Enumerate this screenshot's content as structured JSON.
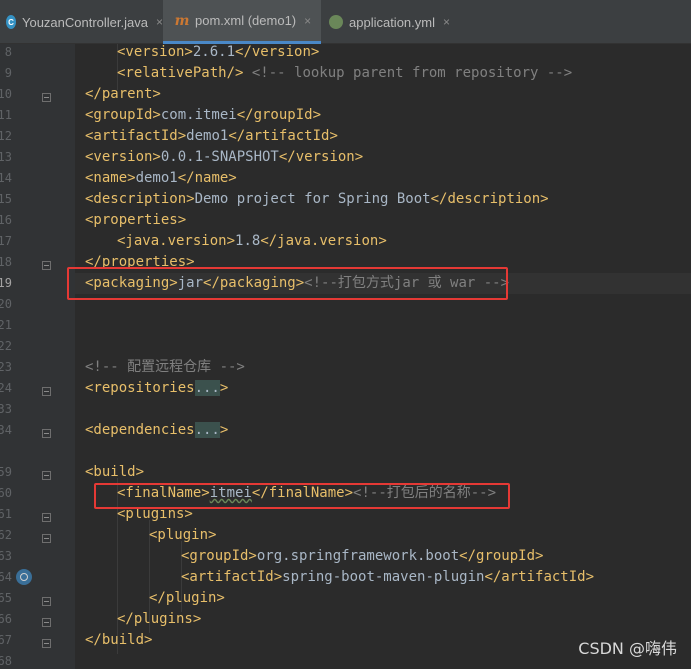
{
  "tabs": [
    {
      "label": "YouzanController.java",
      "icon": "java-class-icon",
      "active": false
    },
    {
      "label": "pom.xml (demo1)",
      "icon": "maven-icon",
      "active": true
    },
    {
      "label": "application.yml",
      "icon": "spring-yaml-icon",
      "active": false
    }
  ],
  "close_glyph": "×",
  "line_numbers": [
    "8",
    "9",
    "10",
    "11",
    "12",
    "13",
    "14",
    "15",
    "16",
    "17",
    "18",
    "19",
    "20",
    "21",
    "22",
    "23",
    "24",
    "33",
    "34",
    "59",
    "60",
    "61",
    "62",
    "63",
    "64",
    "65",
    "66",
    "67",
    "68"
  ],
  "code": {
    "l8": [
      "<version>",
      "2.6.1",
      "</version>"
    ],
    "l9": [
      "<relativePath/>",
      " <!-- lookup parent from repository -->"
    ],
    "l10": [
      "</parent>"
    ],
    "l11": [
      "<groupId>",
      "com.itmei",
      "</groupId>"
    ],
    "l12": [
      "<artifactId>",
      "demo1",
      "</artifactId>"
    ],
    "l13": [
      "<version>",
      "0.0.1-SNAPSHOT",
      "</version>"
    ],
    "l14": [
      "<name>",
      "demo1",
      "</name>"
    ],
    "l15": [
      "<description>",
      "Demo project for Spring Boot",
      "</description>"
    ],
    "l16": [
      "<properties>"
    ],
    "l17": [
      "<java.version>",
      "1.8",
      "</java.version>"
    ],
    "l18": [
      "</properties>"
    ],
    "l19": [
      "<packaging>",
      "jar",
      "</packaging>",
      "<!--打包方式jar 或 war -->"
    ],
    "l23": [
      "<!-- 配置远程仓库 -->"
    ],
    "l24": [
      "<repositories",
      "...",
      ">"
    ],
    "l34": [
      "<dependencies",
      "...",
      ">"
    ],
    "l60": [
      "<build>"
    ],
    "l61": [
      "<finalName>",
      "itmei",
      "</finalName>",
      "<!--打包后的名称-->"
    ],
    "l62": [
      "<plugins>"
    ],
    "l63": [
      "<plugin>"
    ],
    "l64": [
      "<groupId>",
      "org.springframework.boot",
      "</groupId>"
    ],
    "l65": [
      "<artifactId>",
      "spring-boot-maven-plugin",
      "</artifactId>"
    ],
    "l66": [
      "</plugin>"
    ],
    "l67": [
      "</plugins>"
    ],
    "l68": [
      "</build>"
    ]
  },
  "watermark": "CSDN @嗨伟",
  "colors": {
    "tag": "#e8bf6a",
    "text": "#a9b7c6",
    "comment": "#808080",
    "highlight_box": "#e53935"
  }
}
